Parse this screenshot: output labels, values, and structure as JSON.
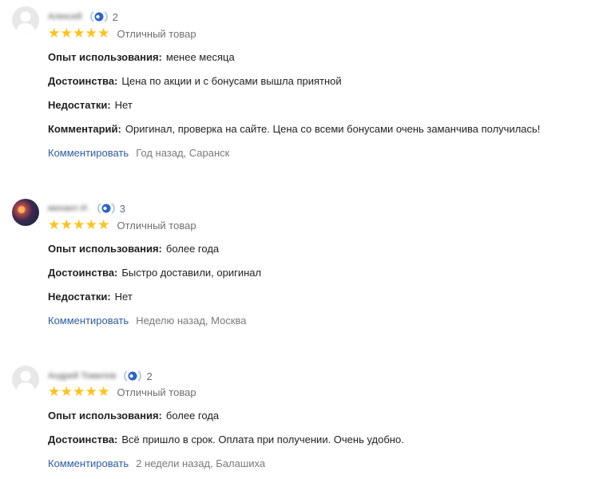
{
  "reviews": [
    {
      "author": "Алексей",
      "badge_count": "2",
      "stars": [
        "★",
        "★",
        "★",
        "★",
        "★"
      ],
      "rating_text": "Отличный товар",
      "usage_label": "Опыт использования:",
      "usage_value": "менее месяца",
      "pros_label": "Достоинства:",
      "pros_value": "Цена по акции и с бонусами вышла приятной",
      "cons_label": "Недостатки:",
      "cons_value": "Нет",
      "comment_label": "Комментарий:",
      "comment_value": "Оригинал, проверка на сайте. Цена со всеми бонусами очень заманчива получилась!",
      "reply_label": "Комментировать",
      "meta": "Год назад, Саранск"
    },
    {
      "author": "михаил И.",
      "badge_count": "3",
      "stars": [
        "★",
        "★",
        "★",
        "★",
        "★"
      ],
      "rating_text": "Отличный товар",
      "usage_label": "Опыт использования:",
      "usage_value": "более года",
      "pros_label": "Достоинства:",
      "pros_value": "Быстро доставили, оригинал",
      "cons_label": "Недостатки:",
      "cons_value": "Нет",
      "reply_label": "Комментировать",
      "meta": "Неделю назад, Москва"
    },
    {
      "author": "Андрей Томилов",
      "badge_count": "2",
      "stars": [
        "★",
        "★",
        "★",
        "★",
        "★"
      ],
      "rating_text": "Отличный товар",
      "usage_label": "Опыт использования:",
      "usage_value": "более года",
      "pros_label": "Достоинства:",
      "pros_value": "Всё пришло в срок. Оплата при получении. Очень удобно.",
      "reply_label": "Комментировать",
      "meta": "2 недели назад, Балашиха"
    }
  ],
  "icons": {
    "avatar_placeholder": "user-silhouette-icon",
    "badge": "laurel-badge-icon",
    "star": "star-icon"
  },
  "colors": {
    "star": "#ffc21a",
    "link": "#2f5c9f",
    "meta": "#7a7a7a",
    "badge": "#2a63c9"
  }
}
